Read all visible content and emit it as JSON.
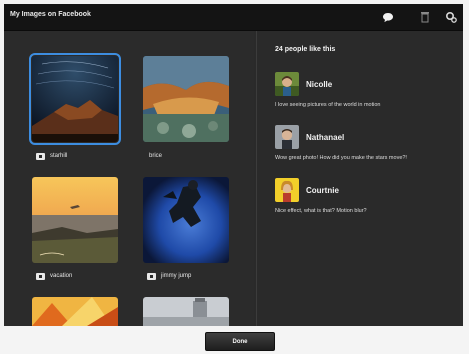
{
  "header": {
    "title": "My Images on Facebook",
    "icons": [
      "comment-icon",
      "trash-icon",
      "settings-icon"
    ]
  },
  "photos": [
    {
      "label": "starhill",
      "selected": true
    },
    {
      "label": "brice",
      "selected": false
    },
    {
      "label": "vacation",
      "selected": false
    },
    {
      "label": "jimmy jump",
      "selected": false
    },
    {
      "label": "",
      "selected": false
    },
    {
      "label": "",
      "selected": false
    }
  ],
  "panel": {
    "likes_text": "24 people like this",
    "comments": [
      {
        "name": "Nicolle",
        "text": "I love seeing pictures of the world in motion"
      },
      {
        "name": "Nathanael",
        "text": "Wow great photo! How did you make the stars move?!"
      },
      {
        "name": "Courtnie",
        "text": "Nice effect, what is that? Motion blur?"
      }
    ]
  },
  "footer": {
    "done_label": "Done"
  }
}
